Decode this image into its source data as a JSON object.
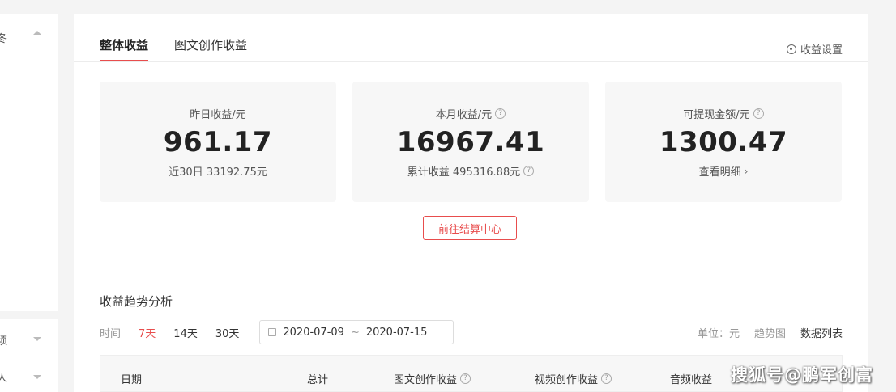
{
  "sidebar": {
    "top_glyph": "冬",
    "item_b": "须",
    "item_c": "人"
  },
  "tabs": [
    {
      "label": "整体收益",
      "active": true
    },
    {
      "label": "图文创作收益",
      "active": false
    }
  ],
  "settings_label": "收益设置",
  "stats": [
    {
      "label": "昨日收益/元",
      "value": "961.17",
      "sub": "近30日 33192.75元",
      "has_help": false
    },
    {
      "label": "本月收益/元",
      "value": "16967.41",
      "sub": "累计收益 495316.88元",
      "has_help": true
    },
    {
      "label": "可提现金额/元",
      "value": "1300.47",
      "sub": "查看明细",
      "has_help": true
    }
  ],
  "settle_button": "前往结算中心",
  "trend": {
    "title": "收益趋势分析",
    "time_label": "时间",
    "ranges": [
      "7天",
      "14天",
      "30天"
    ],
    "active_range": "7天",
    "date_start": "2020-07-09",
    "date_sep": "~",
    "date_end": "2020-07-15",
    "unit": "单位：元",
    "view_chart": "趋势图",
    "view_table": "数据列表"
  },
  "table": {
    "columns": [
      "日期",
      "总计",
      "图文创作收益",
      "视频创作收益",
      "音频收益"
    ]
  },
  "watermark": "搜狐号@鹏军创富",
  "colors": {
    "accent": "#e84d4d",
    "card_bg": "#f7f7f7",
    "page_bg": "#f4f4f4"
  }
}
